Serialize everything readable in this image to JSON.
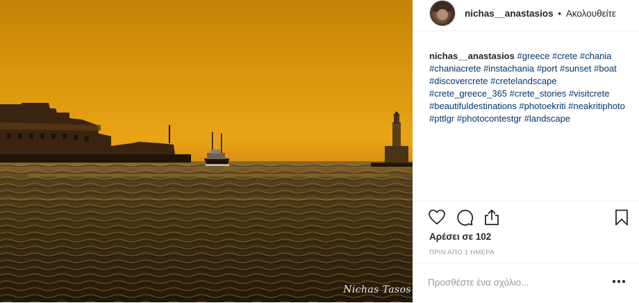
{
  "post": {
    "username": "nichas__anastasios",
    "separator": "•",
    "follow_status": "Ακολουθείτε",
    "caption_user": "nichas__anastasios",
    "hashtags": [
      "#greece",
      "#crete",
      "#chania",
      "#chaniacrete",
      "#instachania",
      "#port",
      "#sunset",
      "#boat",
      "#discovercrete",
      "#cretelandscape",
      "#crete_greece_365",
      "#crete_stories",
      "#visitcrete",
      "#beautifuldestinations",
      "#photoekriti",
      "#neakritiphoto",
      "#pttlgr",
      "#photocontestgr",
      "#landscape"
    ],
    "likes_text": "Αρέσει σε 102",
    "timestamp": "ΠΡΙΝ ΑΠΟ 1 ΗΜΕΡΑ",
    "comment_placeholder": "Προσθέστε ένα σχόλιο...",
    "watermark": "Nichas Tasos"
  },
  "icons": {
    "like": "heart-icon",
    "comment": "comment-icon",
    "share": "share-icon",
    "save": "bookmark-icon",
    "options": "ellipsis-icon"
  },
  "colors": {
    "hashtag": "#003569",
    "text": "#262626",
    "muted": "#999999",
    "divider": "#efefef",
    "sky_top": "#c98a06",
    "sky_horizon": "#e8a215",
    "sea": "#3b2c12"
  }
}
